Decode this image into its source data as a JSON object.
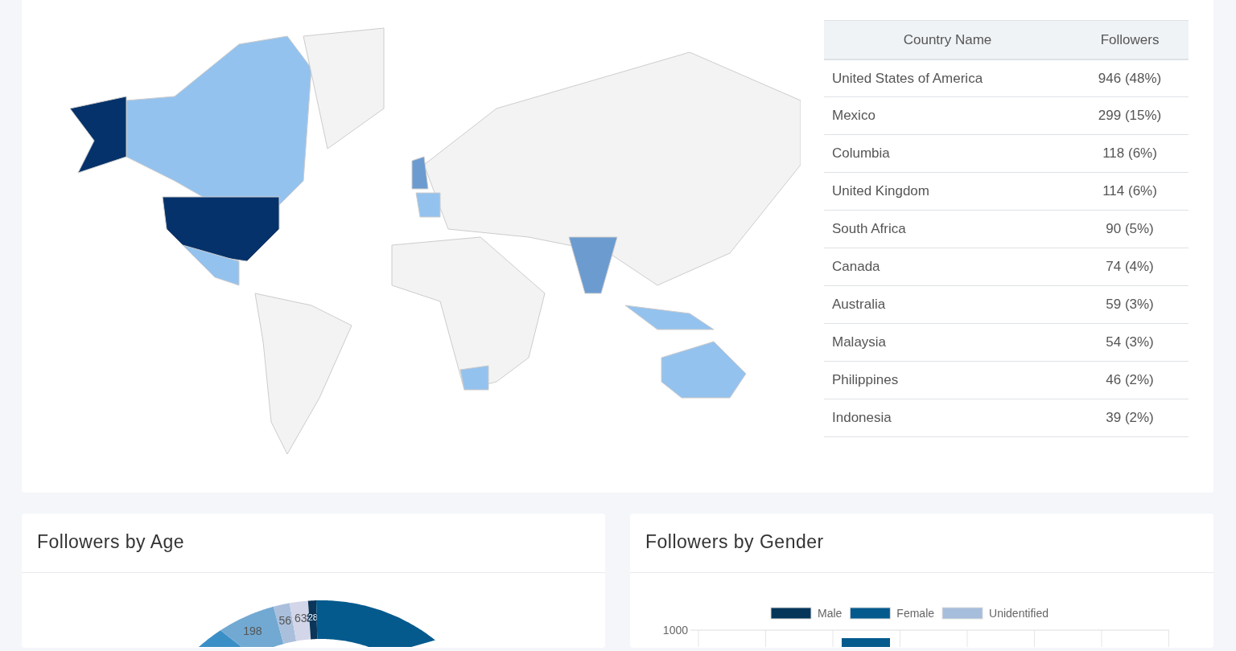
{
  "country_table": {
    "columns": [
      "Country Name",
      "Followers"
    ],
    "rows": [
      [
        "United States of America",
        "946 (48%)"
      ],
      [
        "Mexico",
        "299 (15%)"
      ],
      [
        "Columbia",
        "118 (6%)"
      ],
      [
        "United Kingdom",
        "114 (6%)"
      ],
      [
        "South Africa",
        "90 (5%)"
      ],
      [
        "Canada",
        "74 (4%)"
      ],
      [
        "Australia",
        "59 (3%)"
      ],
      [
        "Malaysia",
        "54 (3%)"
      ],
      [
        "Philippines",
        "46 (2%)"
      ],
      [
        "Indonesia",
        "39 (2%)"
      ]
    ]
  },
  "age_card": {
    "title": "Followers by Age",
    "slices": [
      {
        "color": "#3a8fc7"
      },
      {
        "label": "198",
        "color": "#72a9d2"
      },
      {
        "label": "56",
        "color": "#a9bfdc"
      },
      {
        "label": "63",
        "color": "#d3d6e8"
      },
      {
        "label": "28",
        "color": "#0b3559"
      },
      {
        "color": "#045a8d"
      }
    ]
  },
  "gender_card": {
    "title": "Followers by Gender",
    "legend": [
      {
        "label": "Male",
        "color": "#05365a"
      },
      {
        "label": "Female",
        "color": "#045a8d"
      },
      {
        "label": "Unidentified",
        "color": "#a6bddb"
      }
    ],
    "y_tick": "1000"
  }
}
